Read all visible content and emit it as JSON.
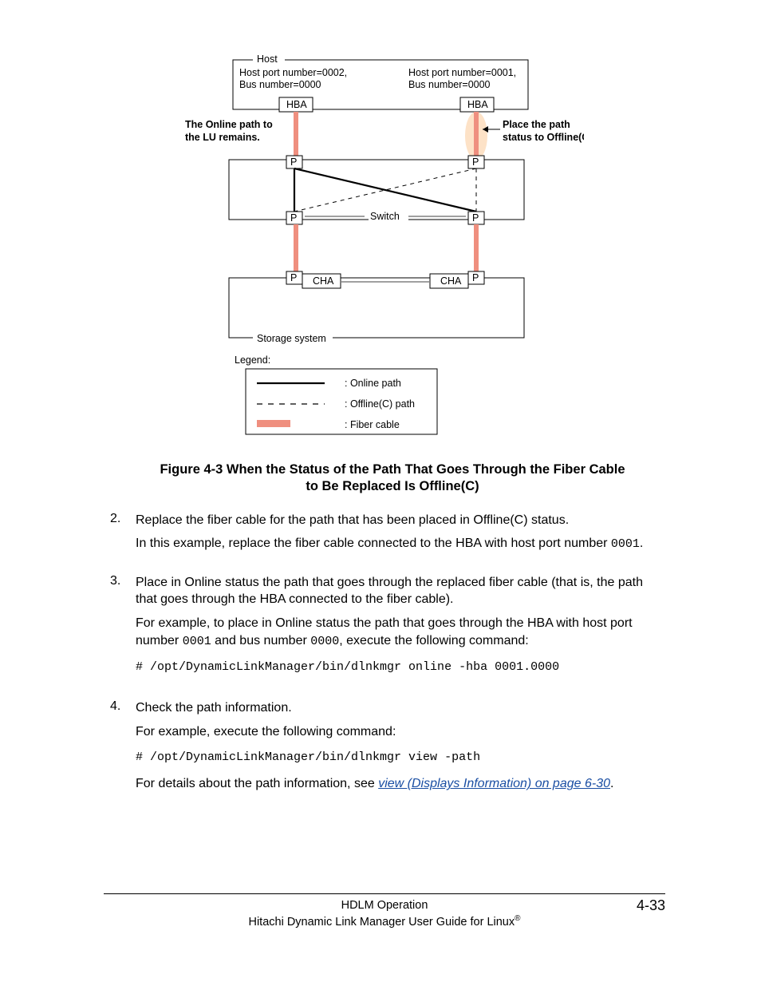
{
  "diagram": {
    "host_label": "Host",
    "left_port": "Host port number=0002,",
    "left_bus": "Bus number=0000",
    "right_port": "Host port number=0001,",
    "right_bus": "Bus number=0000",
    "hba": "HBA",
    "left_note1": "The Online path to",
    "left_note2": "the LU  remains.",
    "right_note1": "Place the path",
    "right_note2": "status to Offline(C).",
    "p": "P",
    "switch": "Switch",
    "cha": "CHA",
    "storage": "Storage system",
    "legend": "Legend:",
    "legend_online": ": Online path",
    "legend_offline": ": Offline(C) path",
    "legend_fiber": ": Fiber cable"
  },
  "caption": "Figure 4-3 When the Status of the Path That Goes Through the Fiber Cable to Be Replaced Is Offline(C)",
  "steps": {
    "s2": {
      "num": "2.",
      "p1": "Replace the fiber cable for the path that has been placed in Offline(C) status.",
      "p2a": "In this example, replace the fiber cable connected to the HBA with host port number ",
      "p2code": "0001",
      "p2b": "."
    },
    "s3": {
      "num": "3.",
      "p1": "Place in Online status the path that goes through the replaced fiber cable (that is, the path that goes through the HBA connected to the fiber cable).",
      "p2a": "For example, to place in Online status the path that goes through the HBA with host port number ",
      "p2code1": "0001",
      "p2b": " and bus number ",
      "p2code2": "0000",
      "p2c": ", execute the following command:",
      "cmd": "# /opt/DynamicLinkManager/bin/dlnkmgr online -hba 0001.0000"
    },
    "s4": {
      "num": "4.",
      "p1": "Check the path information.",
      "p2": "For example, execute the following command:",
      "cmd": "# /opt/DynamicLinkManager/bin/dlnkmgr view -path",
      "p3a": "For details about the path information, see ",
      "link": "view (Displays Information) on page 6-30",
      "p3b": "."
    }
  },
  "footer": {
    "section": "HDLM Operation",
    "book": "Hitachi Dynamic Link Manager User Guide for Linux",
    "page": "4-33"
  }
}
